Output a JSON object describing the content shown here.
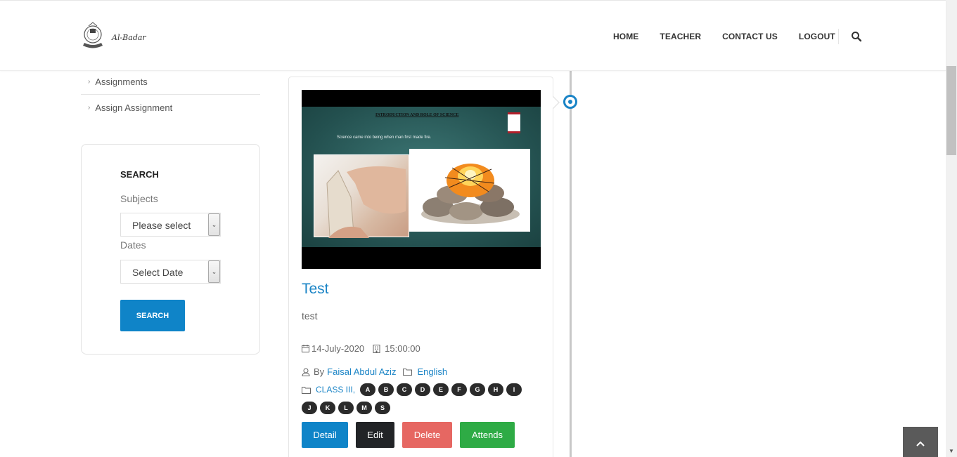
{
  "header": {
    "logo_text": "Al-Badar",
    "nav": [
      "HOME",
      "TEACHER",
      "CONTACT US",
      "LOGOUT"
    ]
  },
  "sidebar": {
    "items": [
      {
        "label": "Assignments"
      },
      {
        "label": "Assign Assignment"
      }
    ]
  },
  "search": {
    "title": "SEARCH",
    "subjects_label": "Subjects",
    "subjects_value": "Please select",
    "dates_label": "Dates",
    "dates_value": "Select Date",
    "button_label": "SEARCH"
  },
  "card": {
    "slide_title": "INTRODUCTION AND ROLE OF SCIENCE",
    "slide_text": "Science came into being when man first made fire.",
    "title": "Test",
    "description": "test",
    "date": "14-July-2020",
    "time": "15:00:00",
    "by_prefix": "By",
    "author": "Faisal Abdul Aziz",
    "subject": "English",
    "class": "CLASS III,",
    "sections_row1": [
      "A",
      "B",
      "C",
      "D",
      "E",
      "F",
      "G",
      "H",
      "I"
    ],
    "sections_row2": [
      "J",
      "K",
      "L",
      "M",
      "S"
    ],
    "buttons": {
      "detail": "Detail",
      "edit": "Edit",
      "delete": "Delete",
      "attends": "Attends"
    }
  },
  "colors": {
    "primary": "#0f84c8",
    "link": "#1a84c6",
    "edit": "#222427",
    "delete": "#e66762",
    "attends": "#2eab45"
  }
}
